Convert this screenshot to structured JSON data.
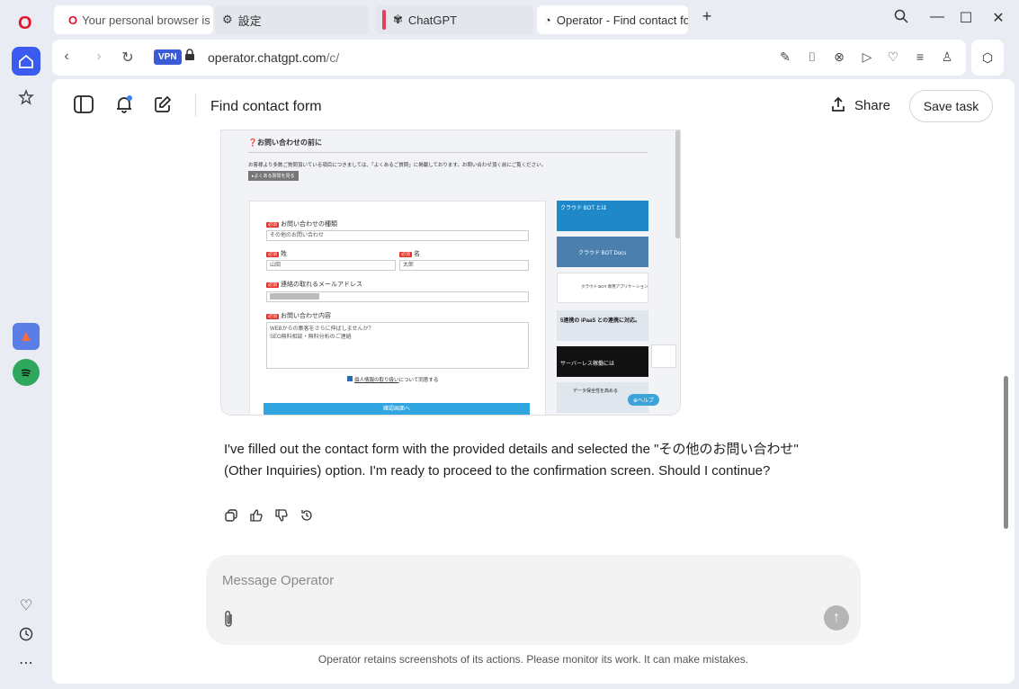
{
  "browser": {
    "tabs": [
      {
        "label": "Your personal browser is a",
        "favicon": "opera-icon",
        "accent": "#7a3cf0"
      },
      {
        "label": "設定",
        "favicon": "gear-icon",
        "accent": ""
      },
      {
        "label": "ChatGPT",
        "favicon": "openai-icon",
        "accent": "#e0405a"
      },
      {
        "label": "Operator - Find contact fo",
        "favicon": "operator-icon",
        "accent": ""
      }
    ],
    "vpn_label": "VPN",
    "url_host": "operator.chatgpt.com",
    "url_path": "/c/",
    "new_tab": "+"
  },
  "header": {
    "title": "Find contact form",
    "share_label": "Share",
    "save_label": "Save task"
  },
  "screenshot": {
    "section_title": "お問い合わせの前に",
    "intro_text": "お客様より多数ご質問頂いている項目につきましては、「よくあるご質問」に掲載しております。お問い合わせ頂く前にご覧ください。",
    "faq_button": "▸よくある質問を見る",
    "required_badge": "必須",
    "inquiry_type_label": "お問い合わせの種類",
    "inquiry_type_value": "その他のお問い合わせ",
    "last_name_label": "姓",
    "last_name_value": "山田",
    "first_name_label": "名",
    "first_name_value": "太郎",
    "email_label": "連絡の取れるメールアドレス",
    "message_label": "お問い合わせ内容",
    "message_line1": "WEBからの集客をさらに伸ばしませんか？",
    "message_line2": "SEO無料相談・無料分析のご連絡",
    "privacy_link": "個人情報の取り扱い",
    "privacy_suffix": "について同意する",
    "submit_label": "確認画面へ",
    "help_label": "ヘルプ",
    "banners": [
      {
        "text": "クラウド BOT とは",
        "bg": "#1e88c8"
      },
      {
        "text": "クラウド BOT Docs",
        "bg": "#4a7fae"
      },
      {
        "text": "クラウド BOT 専用アプリケーション",
        "bg": "#ffffff"
      },
      {
        "text": "5連携の iPaaS との連携に対応。",
        "bg": "#dfe6ee"
      },
      {
        "text": "サーバーレス稼働には",
        "bg": "#111111"
      },
      {
        "text": "データ保全性を高める",
        "bg": "#dfe6ee"
      }
    ]
  },
  "message": {
    "text": "I've filled out the contact form with the provided details and selected the \"その他のお問い合わせ\" (Other Inquiries) option. I'm ready to proceed to the confirmation screen. Should I continue?"
  },
  "composer": {
    "placeholder": "Message Operator"
  },
  "disclaimer": "Operator retains screenshots of its actions. Please monitor its work. It can make mistakes.",
  "colors": {
    "opera_red": "#e5122a",
    "vpn_blue": "#3b5bd6",
    "sidebar_active": "#3b5bf0",
    "submit_blue": "#30a5e0",
    "required_red": "#e2342b"
  }
}
